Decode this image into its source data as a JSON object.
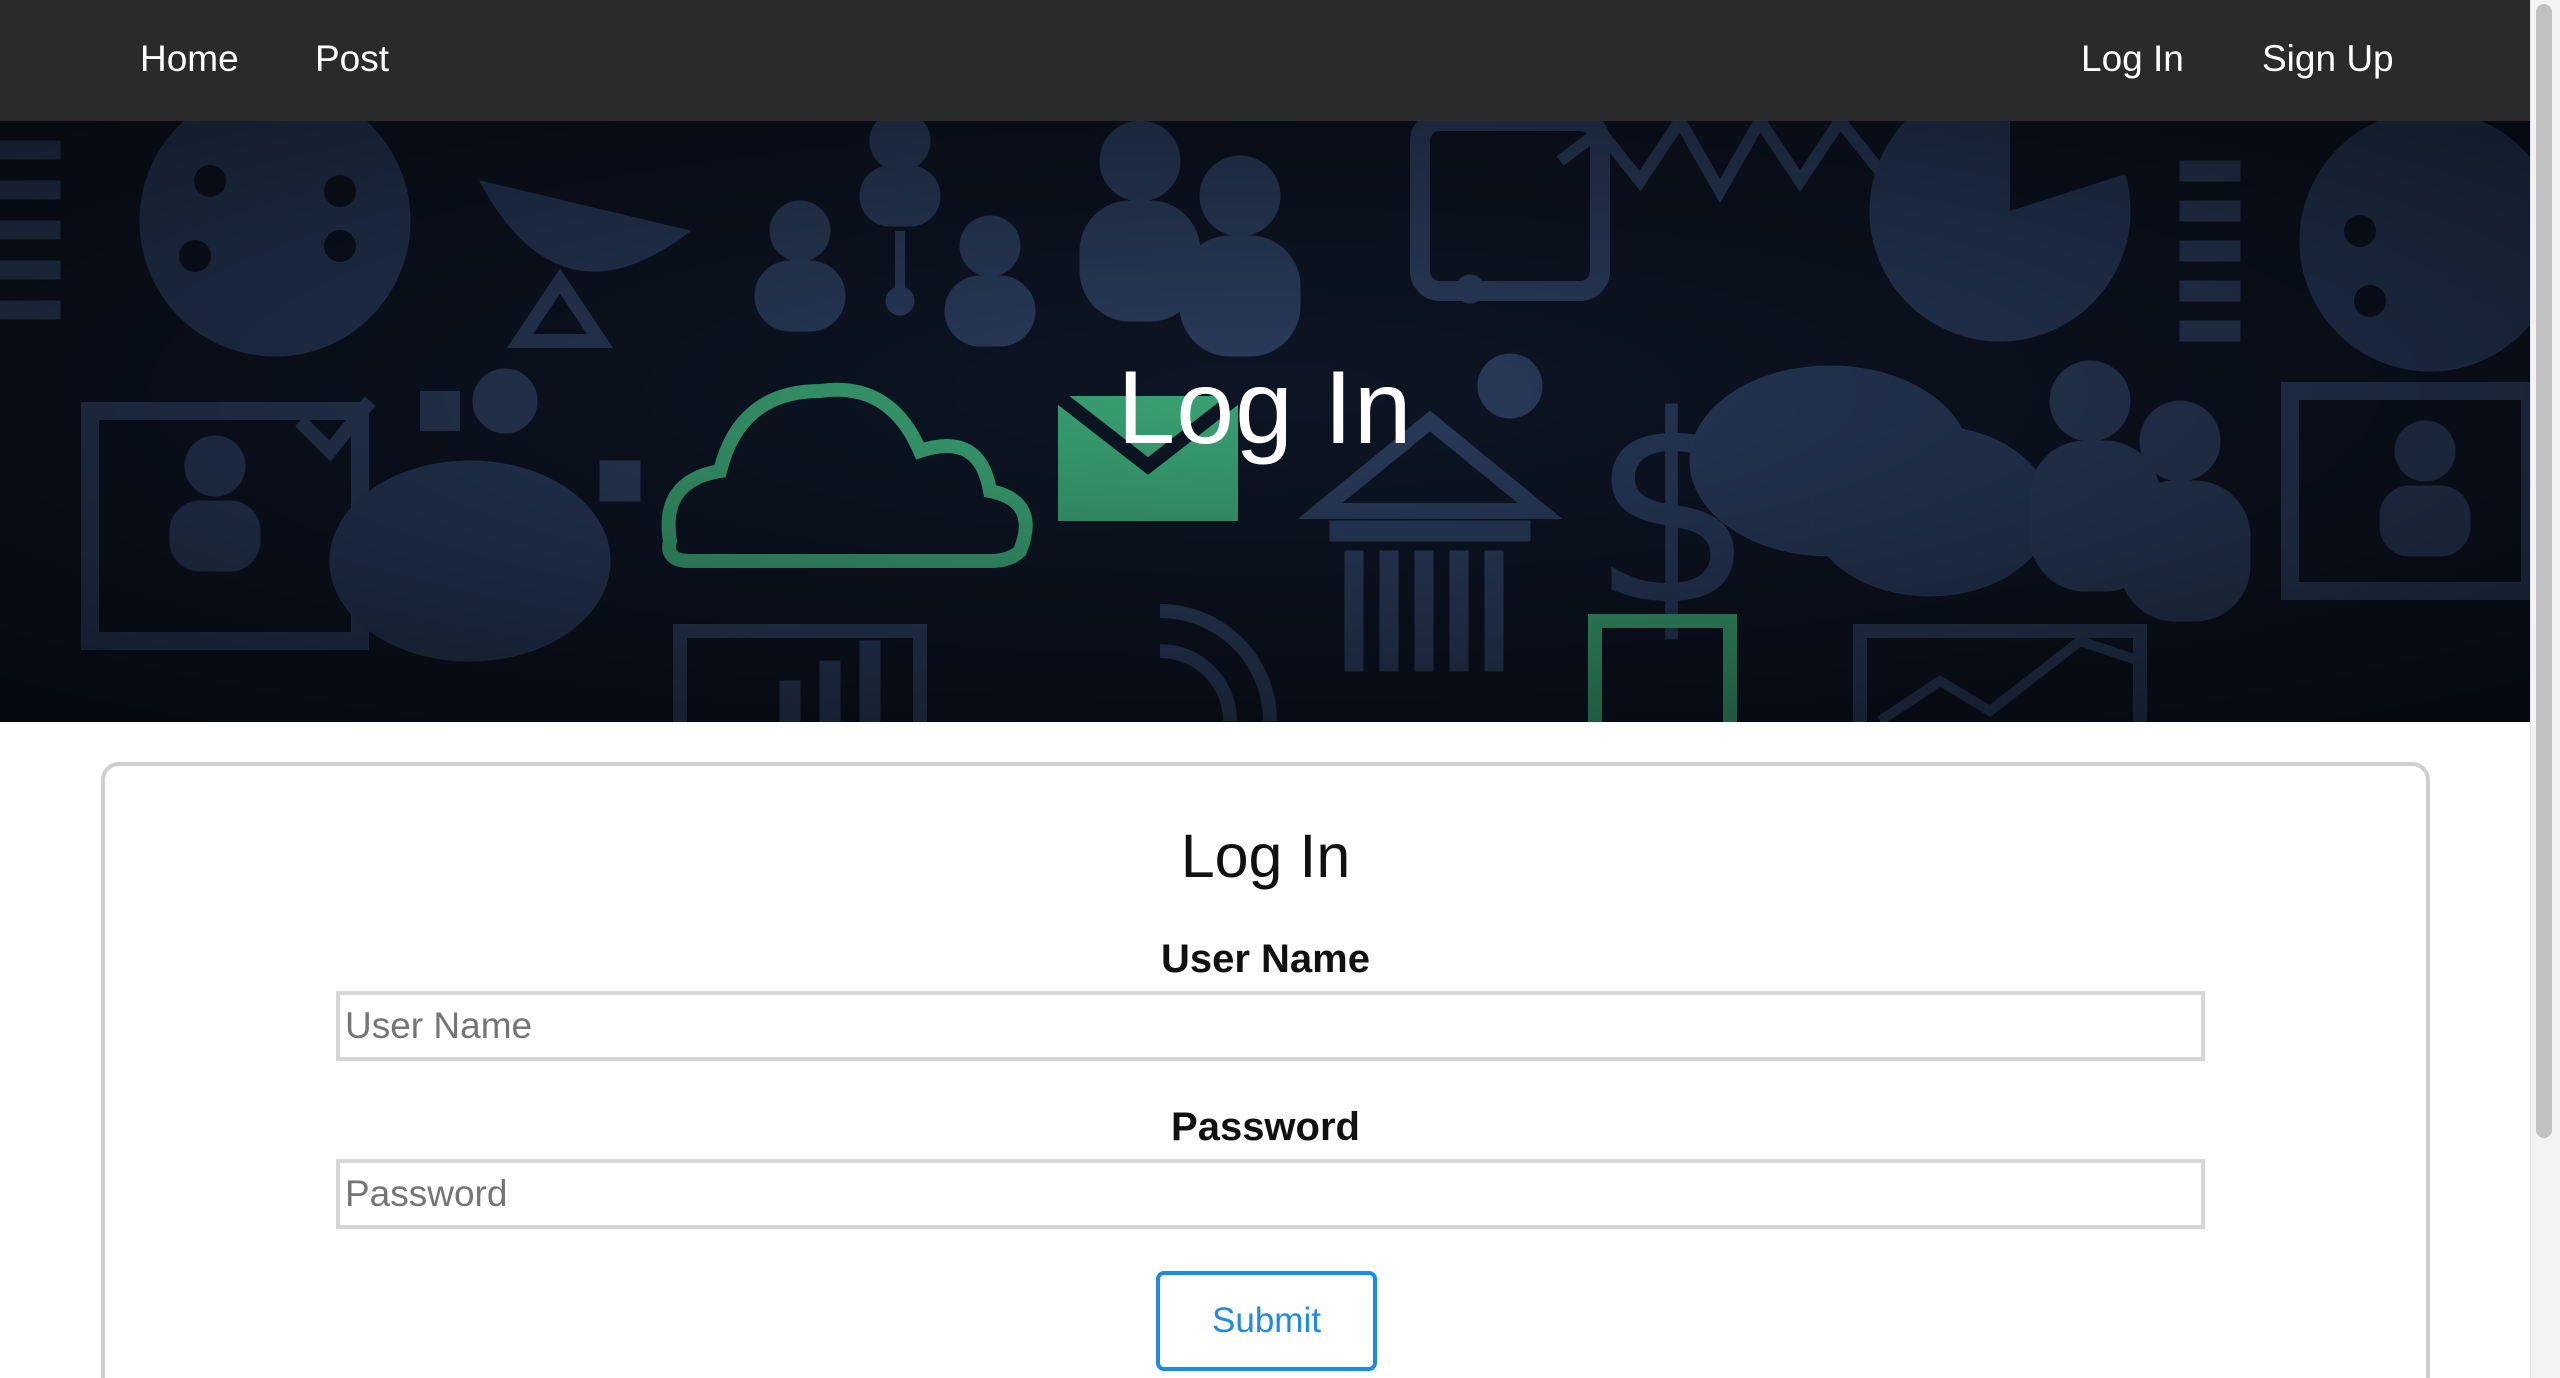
{
  "navbar": {
    "left_links": [
      {
        "label": "Home"
      },
      {
        "label": "Post"
      }
    ],
    "right_links": [
      {
        "label": "Log In"
      },
      {
        "label": "Sign Up"
      }
    ],
    "background_color": "#2a2a2a"
  },
  "hero": {
    "title": "Log In",
    "icon_color": "#2a3c5c",
    "accent_color": "#3aa374"
  },
  "form": {
    "title": "Log In",
    "username": {
      "label": "User Name",
      "placeholder": "User Name",
      "value": ""
    },
    "password": {
      "label": "Password",
      "placeholder": "Password",
      "value": ""
    },
    "submit_label": "Submit",
    "submit_color": "#1f8ae6"
  }
}
